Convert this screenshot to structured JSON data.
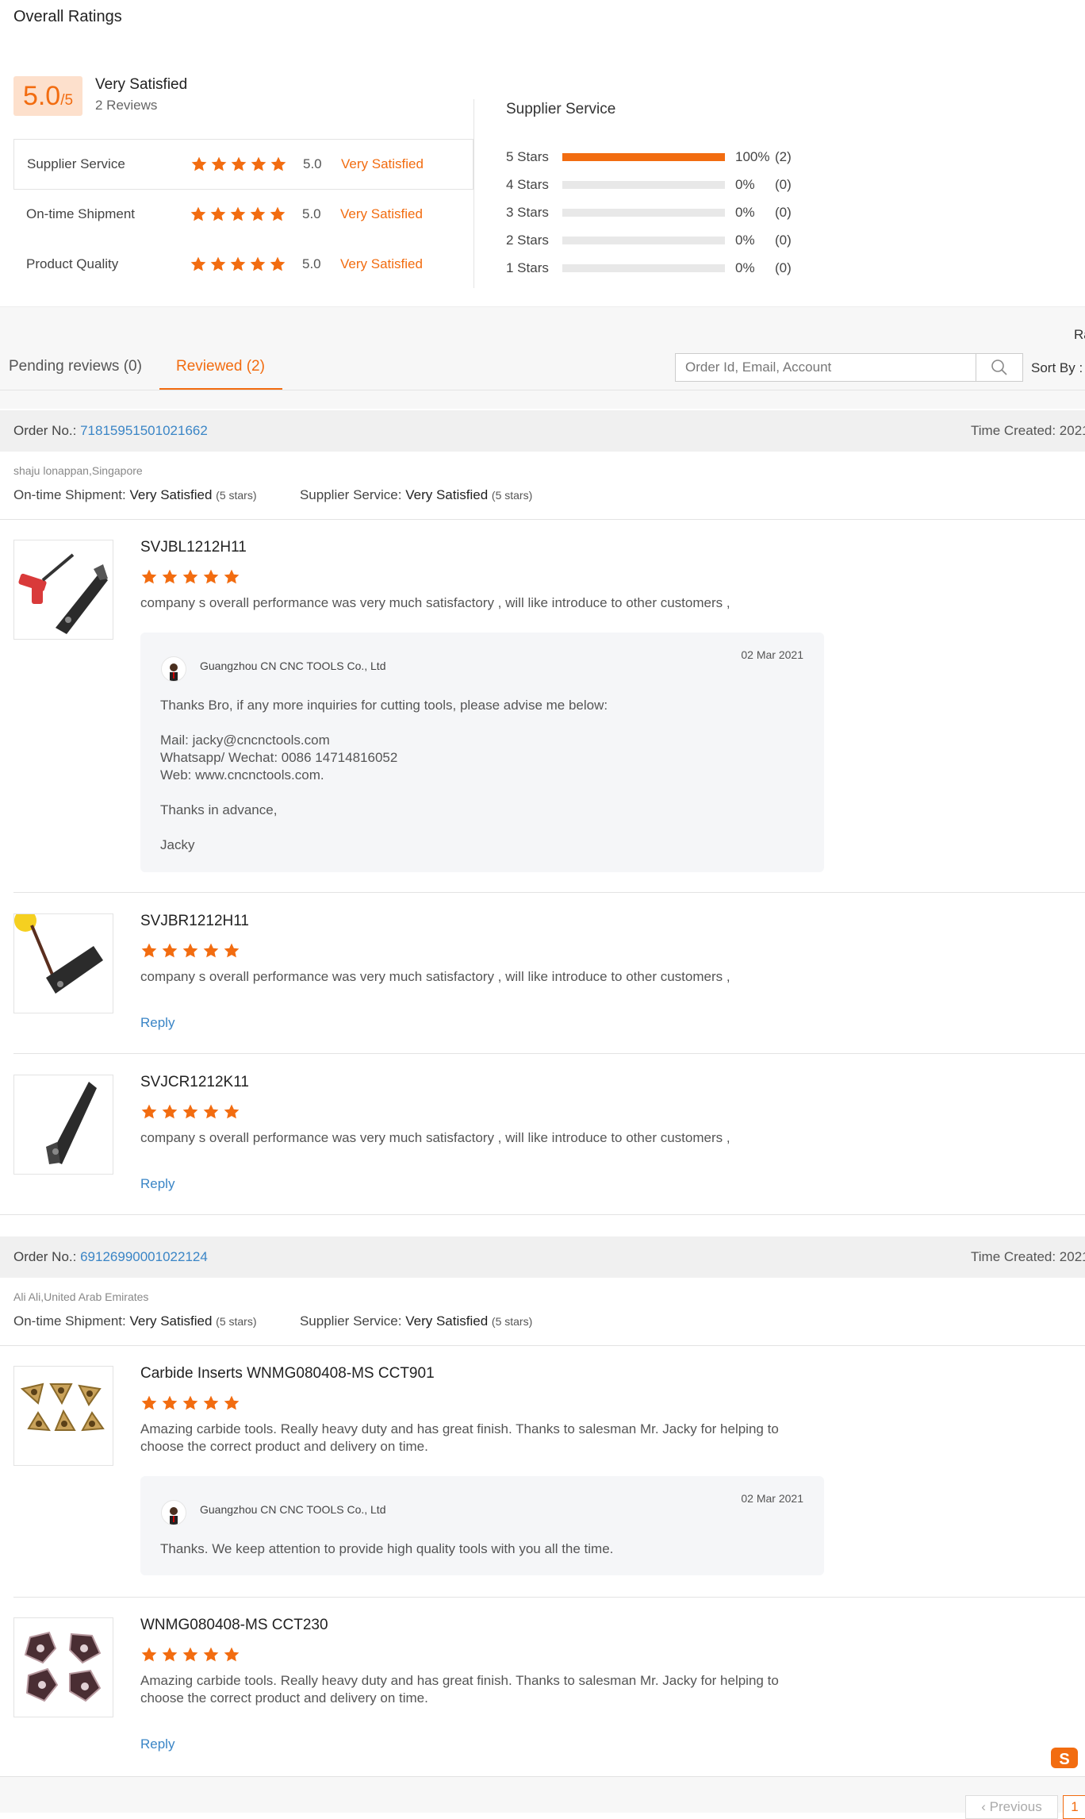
{
  "overall": {
    "title": "Overall Ratings",
    "score": "5.0",
    "score_max": "/5",
    "label": "Very Satisfied",
    "reviews_count": "2 Reviews",
    "rows": [
      {
        "label": "Supplier Service",
        "score": "5.0",
        "satisfaction": "Very Satisfied",
        "stars": 5
      },
      {
        "label": "On-time Shipment",
        "score": "5.0",
        "satisfaction": "Very Satisfied",
        "stars": 5
      },
      {
        "label": "Product Quality",
        "score": "5.0",
        "satisfaction": "Very Satisfied",
        "stars": 5
      }
    ]
  },
  "supplier_distribution": {
    "title": "Supplier Service",
    "rows": [
      {
        "label": "5 Stars",
        "pct": "100%",
        "count": "(2)",
        "fraction": 1.0
      },
      {
        "label": "4 Stars",
        "pct": "0%",
        "count": "(0)",
        "fraction": 0
      },
      {
        "label": "3 Stars",
        "pct": "0%",
        "count": "(0)",
        "fraction": 0
      },
      {
        "label": "2 Stars",
        "pct": "0%",
        "count": "(0)",
        "fraction": 0
      },
      {
        "label": "1 Stars",
        "pct": "0%",
        "count": "(0)",
        "fraction": 0
      }
    ]
  },
  "toolbar": {
    "ra_text": "Ra",
    "tabs": [
      "Pending reviews (0)",
      "Reviewed (2)"
    ],
    "search_placeholder": "Order Id, Email, Account",
    "sort_by": "Sort By :"
  },
  "orders": [
    {
      "order_label": "Order No.:",
      "order_no": "71815951501021662",
      "time_created": "Time Created: 2021",
      "buyer": "shaju lonappan,Singapore",
      "shipment_label": "On-time Shipment:",
      "shipment_value": "Very Satisfied",
      "shipment_stars": "(5 stars)",
      "service_label": "Supplier Service:",
      "service_value": "Very Satisfied",
      "service_stars": "(5 stars)",
      "items": [
        {
          "name": "SVJBL1212H11",
          "stars": 5,
          "comment": "company s  overall performance  was  very much  satisfactory , will like  introduce  to other  customers ,",
          "reply": {
            "company": "Guangzhou CN CNC TOOLS Co., Ltd",
            "date": "02 Mar 2021",
            "lines": [
              "Thanks Bro, if any more inquiries for cutting tools, please advise me below:",
              "Mail: jacky@cncnctools.com",
              "Whatsapp/ Wechat: 0086 14714816052",
              "Web: www.cncnctools.com.",
              "Thanks in advance,",
              "Jacky"
            ]
          }
        },
        {
          "name": "SVJBR1212H11",
          "stars": 5,
          "comment": "company s  overall performance  was  very much  satisfactory , will like  introduce  to other  customers ,",
          "reply_link": "Reply"
        },
        {
          "name": "SVJCR1212K11",
          "stars": 5,
          "comment": "company s  overall performance  was  very much  satisfactory , will like  introduce  to other  customers ,",
          "reply_link": "Reply"
        }
      ]
    },
    {
      "order_label": "Order No.:",
      "order_no": "69126990001022124",
      "time_created": "Time Created: 2021",
      "buyer": "Ali Ali,United Arab Emirates",
      "shipment_label": "On-time Shipment:",
      "shipment_value": "Very Satisfied",
      "shipment_stars": "(5 stars)",
      "service_label": "Supplier Service:",
      "service_value": "Very Satisfied",
      "service_stars": "(5 stars)",
      "items": [
        {
          "name": "Carbide Inserts WNMG080408-MS CCT901",
          "stars": 5,
          "comment_lines": [
            "Amazing carbide tools. Really heavy duty and has great finish. Thanks to salesman Mr. Jacky for helping to",
            "choose the correct product and delivery on time."
          ],
          "reply": {
            "company": "Guangzhou CN CNC TOOLS Co., Ltd",
            "date": "02 Mar 2021",
            "lines": [
              "Thanks. We keep attention to provide high quality tools with you all the time."
            ]
          }
        },
        {
          "name": "WNMG080408-MS CCT230",
          "stars": 5,
          "comment_lines": [
            "Amazing carbide tools. Really heavy duty and has great finish. Thanks to salesman Mr. Jacky for helping to",
            "choose the correct product and delivery on time."
          ],
          "reply_link": "Reply"
        }
      ]
    }
  ],
  "pagination": {
    "previous": "‹ Previous",
    "current": "1"
  },
  "colors": {
    "accent": "#f26c10",
    "link": "#3a85c6",
    "score_bg": "#fde0cc"
  }
}
